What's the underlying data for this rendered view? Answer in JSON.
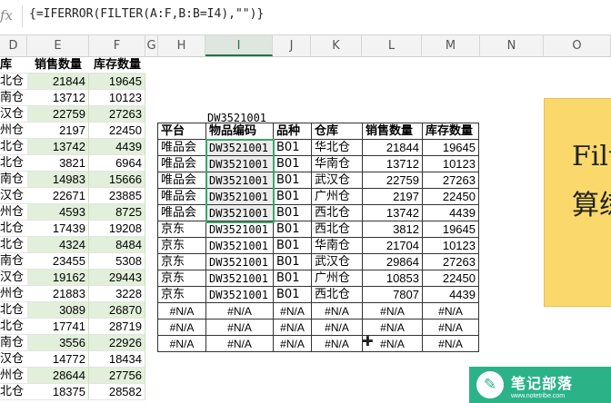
{
  "formula_bar": {
    "fx_label": "fx",
    "formula": "{=IFERROR(FILTER(A:F,B:B=I4),\"\")}"
  },
  "columns": [
    "D",
    "E",
    "F",
    "G",
    "H",
    "I",
    "J",
    "K",
    "L",
    "M",
    "N",
    "O"
  ],
  "selected_column": "I",
  "left_table": {
    "headers": [
      "库",
      "销售数量",
      "库存数量"
    ],
    "rows": [
      [
        "北仓",
        "21844",
        "19645"
      ],
      [
        "南仓",
        "13712",
        "10123"
      ],
      [
        "汉仓",
        "22759",
        "27263"
      ],
      [
        "州仓",
        "2197",
        "22450"
      ],
      [
        "北仓",
        "13742",
        "4439"
      ],
      [
        "北仓",
        "3821",
        "6964"
      ],
      [
        "南仓",
        "14983",
        "15666"
      ],
      [
        "汉仓",
        "22671",
        "23885"
      ],
      [
        "州仓",
        "4593",
        "8725"
      ],
      [
        "北仓",
        "17439",
        "19208"
      ],
      [
        "北仓",
        "4324",
        "8484"
      ],
      [
        "南仓",
        "23455",
        "5308"
      ],
      [
        "汉仓",
        "19162",
        "29443"
      ],
      [
        "州仓",
        "21883",
        "3228"
      ],
      [
        "北仓",
        "3089",
        "26870"
      ],
      [
        "北仓",
        "17741",
        "28719"
      ],
      [
        "南仓",
        "3556",
        "22926"
      ],
      [
        "汉仓",
        "14772",
        "18434"
      ],
      [
        "州仓",
        "28644",
        "27756"
      ],
      [
        "北仓",
        "18375",
        "28582"
      ]
    ]
  },
  "criteria_value": "DW3521001",
  "result_table": {
    "headers": [
      "平台",
      "物品编码",
      "品种",
      "仓库",
      "销售数量",
      "库存数量"
    ],
    "rows": [
      [
        "唯品会",
        "DW3521001",
        "B01",
        "华北仓",
        "21844",
        "19645"
      ],
      [
        "唯品会",
        "DW3521001",
        "B01",
        "华南仓",
        "13712",
        "10123"
      ],
      [
        "唯品会",
        "DW3521001",
        "B01",
        "武汉仓",
        "22759",
        "27263"
      ],
      [
        "唯品会",
        "DW3521001",
        "B01",
        "广州仓",
        "2197",
        "22450"
      ],
      [
        "唯品会",
        "DW3521001",
        "B01",
        "西北仓",
        "13742",
        "4439"
      ],
      [
        "京东",
        "DW3521001",
        "B01",
        "西北仓",
        "3812",
        "19645"
      ],
      [
        "京东",
        "DW3521001",
        "B01",
        "华南仓",
        "21704",
        "10123"
      ],
      [
        "京东",
        "DW3521001",
        "B01",
        "武汉仓",
        "29864",
        "27263"
      ],
      [
        "京东",
        "DW3521001",
        "B01",
        "广州仓",
        "10853",
        "22450"
      ],
      [
        "京东",
        "DW3521001",
        "B01",
        "西北仓",
        "7807",
        "4439"
      ],
      [
        "#N/A",
        "#N/A",
        "#N/A",
        "#N/A",
        "#N/A",
        "#N/A"
      ],
      [
        "#N/A",
        "#N/A",
        "#N/A",
        "#N/A",
        "#N/A",
        "#N/A"
      ],
      [
        "#N/A",
        "#N/A",
        "#N/A",
        "#N/A",
        "#N/A",
        "#N/A"
      ]
    ]
  },
  "note_box": {
    "line1": "Filt",
    "line2": "算练"
  },
  "watermark": {
    "title": "笔记部落",
    "url": "www.notetribe.com",
    "icon": "pencil-icon"
  },
  "colors": {
    "accent_green": "#217346",
    "band_green": "#e2efda",
    "selection": "#3aa86b",
    "note_yellow": "#fbd86b",
    "logo_green": "#2bb387"
  }
}
